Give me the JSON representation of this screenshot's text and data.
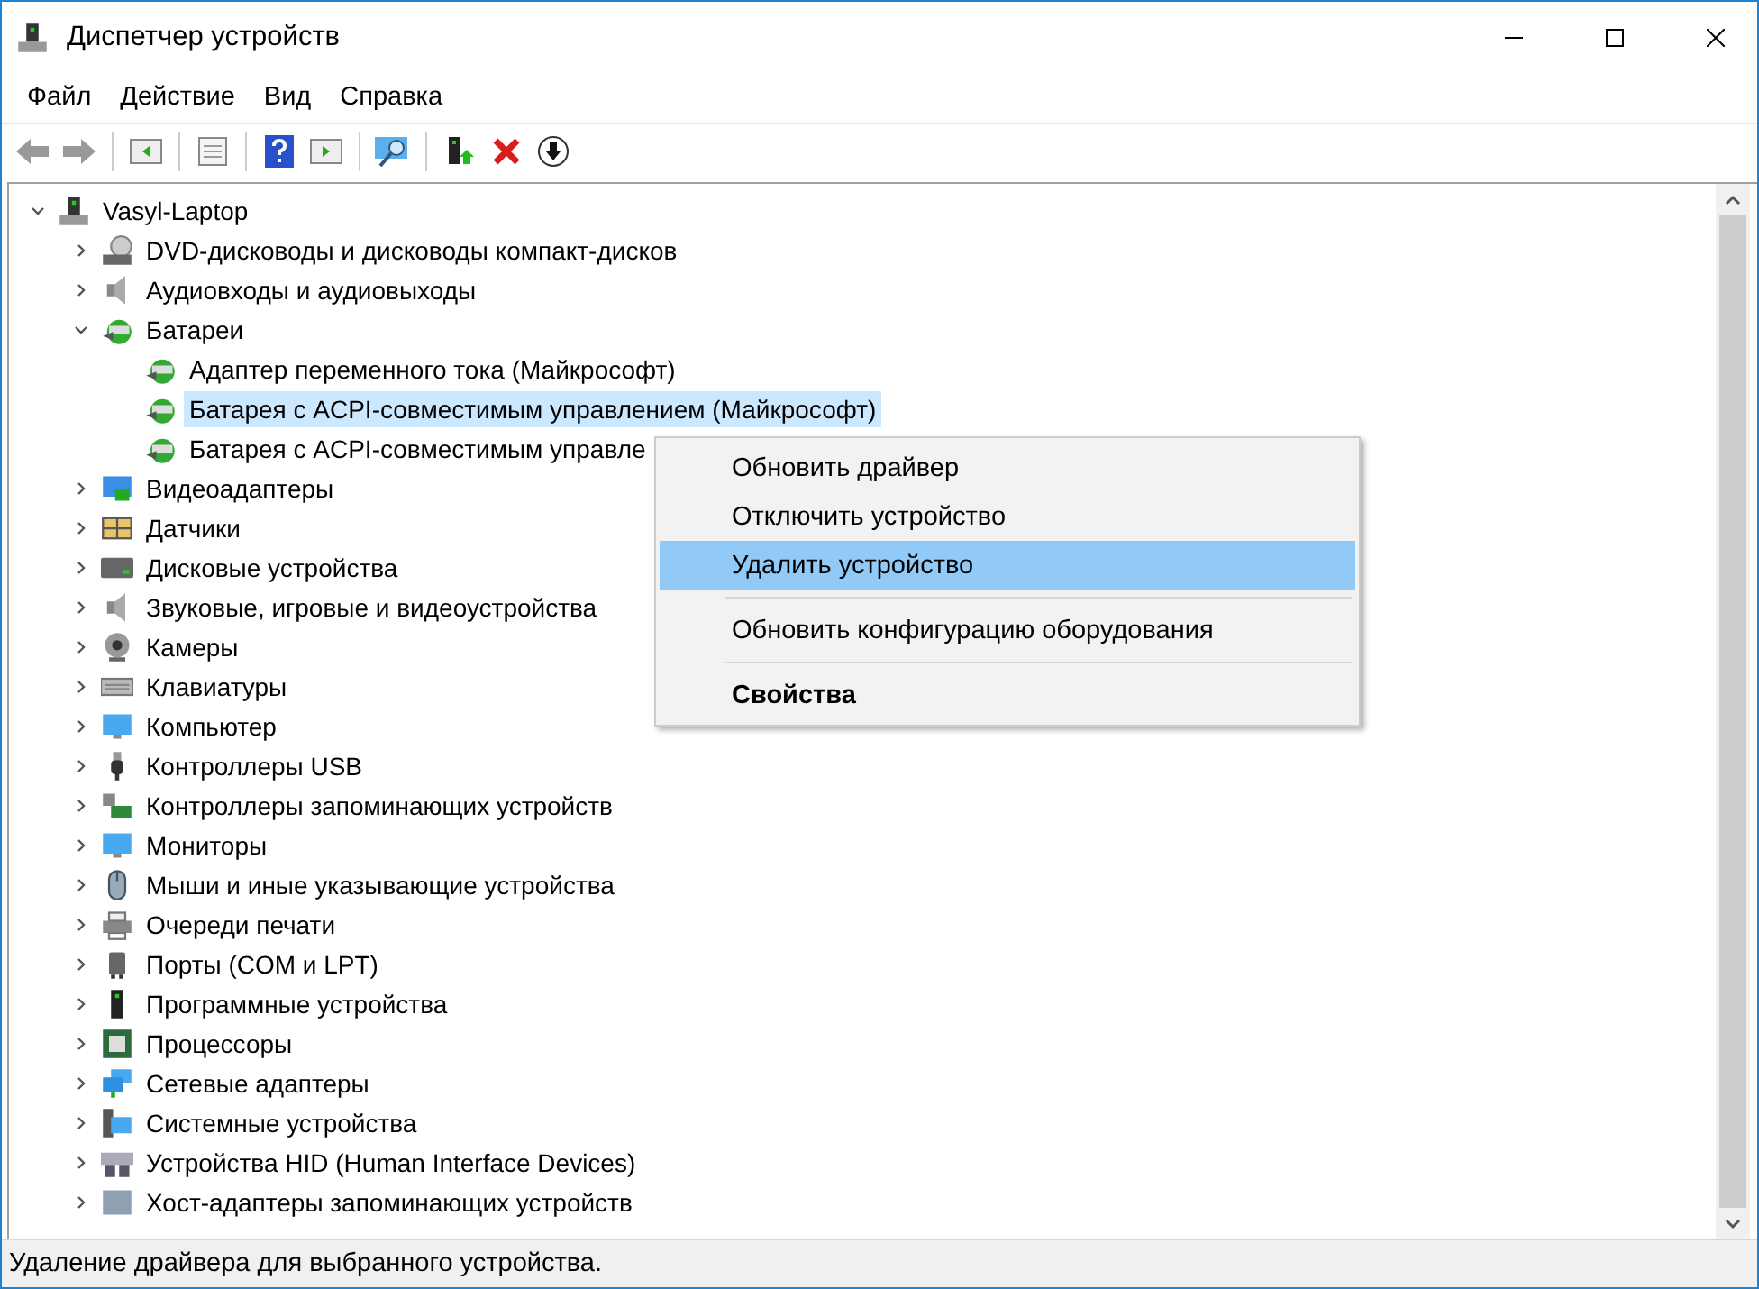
{
  "window": {
    "title": "Диспетчер устройств"
  },
  "menu": [
    "Файл",
    "Действие",
    "Вид",
    "Справка"
  ],
  "tree": {
    "label": "Vasyl-Laptop",
    "expanded": true,
    "selected": false,
    "children": [
      {
        "label": "DVD-дисководы и дисководы компакт-дисков",
        "expanded": false,
        "selected": false
      },
      {
        "label": "Аудиовходы и аудиовыходы",
        "expanded": false,
        "selected": false
      },
      {
        "label": "Батареи",
        "expanded": true,
        "selected": false,
        "children": [
          {
            "label": "Адаптер переменного тока (Майкрософт)",
            "selected": false
          },
          {
            "label": "Батарея с ACPI-совместимым управлением (Майкрософт)",
            "selected": true
          },
          {
            "label": "Батарея с ACPI-совместимым управле",
            "selected": false
          }
        ]
      },
      {
        "label": "Видеоадаптеры",
        "expanded": false,
        "selected": false
      },
      {
        "label": "Датчики",
        "expanded": false,
        "selected": false
      },
      {
        "label": "Дисковые устройства",
        "expanded": false,
        "selected": false
      },
      {
        "label": "Звуковые, игровые и видеоустройства",
        "expanded": false,
        "selected": false
      },
      {
        "label": "Камеры",
        "expanded": false,
        "selected": false
      },
      {
        "label": "Клавиатуры",
        "expanded": false,
        "selected": false
      },
      {
        "label": "Компьютер",
        "expanded": false,
        "selected": false
      },
      {
        "label": "Контроллеры USB",
        "expanded": false,
        "selected": false
      },
      {
        "label": "Контроллеры запоминающих устройств",
        "expanded": false,
        "selected": false
      },
      {
        "label": "Мониторы",
        "expanded": false,
        "selected": false
      },
      {
        "label": "Мыши и иные указывающие устройства",
        "expanded": false,
        "selected": false
      },
      {
        "label": "Очереди печати",
        "expanded": false,
        "selected": false
      },
      {
        "label": "Порты (COM и LPT)",
        "expanded": false,
        "selected": false
      },
      {
        "label": "Программные устройства",
        "expanded": false,
        "selected": false
      },
      {
        "label": "Процессоры",
        "expanded": false,
        "selected": false
      },
      {
        "label": "Сетевые адаптеры",
        "expanded": false,
        "selected": false
      },
      {
        "label": "Системные устройства",
        "expanded": false,
        "selected": false
      },
      {
        "label": "Устройства HID (Human Interface Devices)",
        "expanded": false,
        "selected": false
      },
      {
        "label": "Хост-адаптеры запоминающих устройств",
        "expanded": false,
        "selected": false
      }
    ]
  },
  "context_menu": [
    {
      "label": "Обновить драйвер",
      "selected": false,
      "bold": false,
      "separator_after": false
    },
    {
      "label": "Отключить устройство",
      "selected": false,
      "bold": false,
      "separator_after": false
    },
    {
      "label": "Удалить устройство",
      "selected": true,
      "bold": false,
      "separator_after": true
    },
    {
      "label": "Обновить конфигурацию оборудования",
      "selected": false,
      "bold": false,
      "separator_after": true
    },
    {
      "label": "Свойства",
      "selected": false,
      "bold": true,
      "separator_after": false
    }
  ],
  "status_bar": "Удаление драйвера для выбранного устройства."
}
